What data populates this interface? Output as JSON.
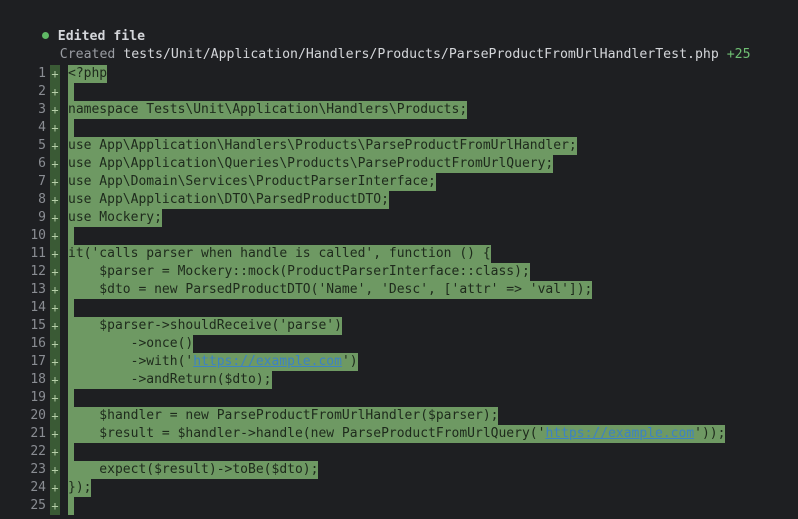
{
  "header": {
    "title": "Edited file",
    "verb": "Created",
    "file_path": "tests/Unit/Application/Handlers/Products/ParseProductFromUrlHandlerTest.php",
    "added_count": "+25"
  },
  "diff": {
    "marker": "+",
    "lines": [
      {
        "num": "1",
        "text": "<?php"
      },
      {
        "num": "2",
        "text": ""
      },
      {
        "num": "3",
        "text": "namespace Tests\\Unit\\Application\\Handlers\\Products;"
      },
      {
        "num": "4",
        "text": ""
      },
      {
        "num": "5",
        "text": "use App\\Application\\Handlers\\Products\\ParseProductFromUrlHandler;"
      },
      {
        "num": "6",
        "text": "use App\\Application\\Queries\\Products\\ParseProductFromUrlQuery;"
      },
      {
        "num": "7",
        "text": "use App\\Domain\\Services\\ProductParserInterface;"
      },
      {
        "num": "8",
        "text": "use App\\Application\\DTO\\ParsedProductDTO;"
      },
      {
        "num": "9",
        "text": "use Mockery;"
      },
      {
        "num": "10",
        "text": ""
      },
      {
        "num": "11",
        "text": "it('calls parser when handle is called', function () {"
      },
      {
        "num": "12",
        "text": "    $parser = Mockery::mock(ProductParserInterface::class);"
      },
      {
        "num": "13",
        "text": "    $dto = new ParsedProductDTO('Name', 'Desc', ['attr' => 'val']);"
      },
      {
        "num": "14",
        "text": ""
      },
      {
        "num": "15",
        "text": "    $parser->shouldReceive('parse')"
      },
      {
        "num": "16",
        "text": "        ->once()"
      },
      {
        "num": "17",
        "pre": "        ->with('",
        "url": "https://example.com",
        "post": "')"
      },
      {
        "num": "18",
        "text": "        ->andReturn($dto);"
      },
      {
        "num": "19",
        "text": ""
      },
      {
        "num": "20",
        "text": "    $handler = new ParseProductFromUrlHandler($parser);"
      },
      {
        "num": "21",
        "pre": "    $result = $handler->handle(new ParseProductFromUrlQuery('",
        "url": "https://example.com",
        "post": "'));"
      },
      {
        "num": "22",
        "text": ""
      },
      {
        "num": "23",
        "text": "    expect($result)->toBe($dto);"
      },
      {
        "num": "24",
        "text": "});"
      },
      {
        "num": "25",
        "text": ""
      }
    ]
  }
}
